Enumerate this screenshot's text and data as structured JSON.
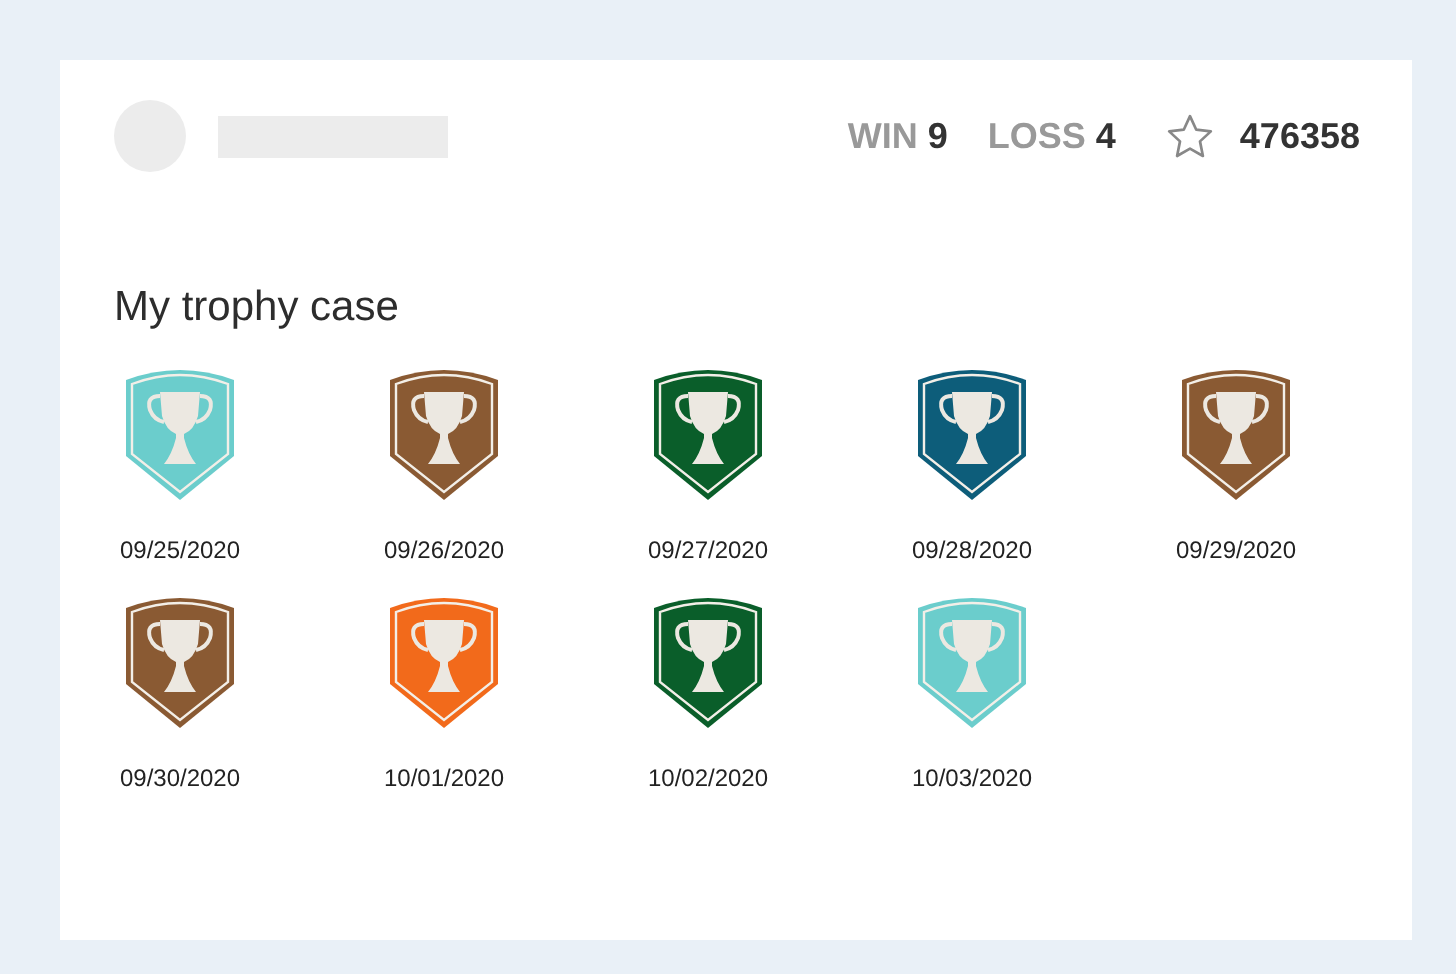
{
  "stats": {
    "win_label": "WIN",
    "win_value": "9",
    "loss_label": "LOSS",
    "loss_value": "4",
    "points": "476358"
  },
  "section_title": "My trophy case",
  "trophies": [
    {
      "date": "09/25/2020",
      "color": "#6bcdcc"
    },
    {
      "date": "09/26/2020",
      "color": "#8a5a33"
    },
    {
      "date": "09/27/2020",
      "color": "#0a5e2a"
    },
    {
      "date": "09/28/2020",
      "color": "#0d5d7a"
    },
    {
      "date": "09/29/2020",
      "color": "#8a5a33"
    },
    {
      "date": "09/30/2020",
      "color": "#8a5a33"
    },
    {
      "date": "10/01/2020",
      "color": "#f26a1b"
    },
    {
      "date": "10/02/2020",
      "color": "#0a5e2a"
    },
    {
      "date": "10/03/2020",
      "color": "#6bcdcc"
    }
  ]
}
